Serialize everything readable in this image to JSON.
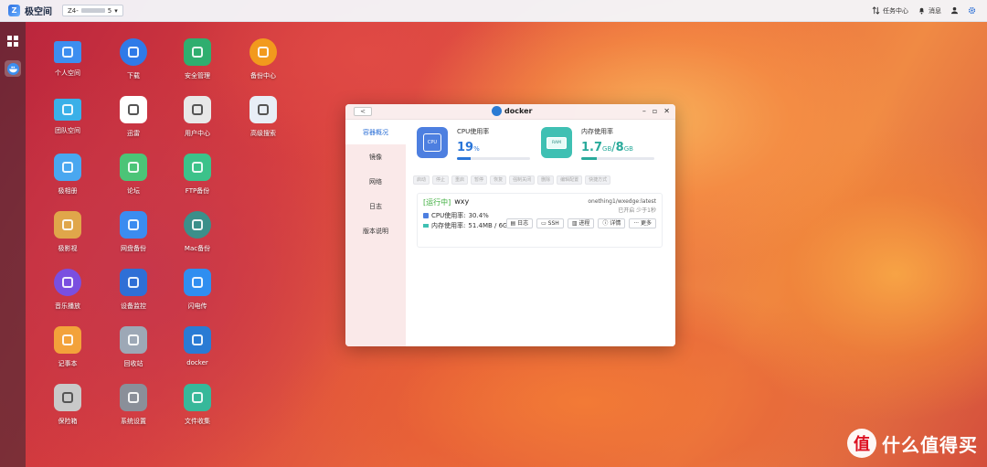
{
  "topbar": {
    "app_name": "极空间",
    "device_name": "Z4-",
    "device_suffix": "5",
    "task_center": "任务中心",
    "messages": "消息"
  },
  "desktop_icons": [
    {
      "label": "个人空间",
      "icon": "folder-icon",
      "color": "#3d8ef0"
    },
    {
      "label": "下载",
      "icon": "download-globe-icon",
      "color": "#2f7ae8"
    },
    {
      "label": "安全管理",
      "icon": "shield-icon",
      "color": "#2fae6f"
    },
    {
      "label": "备份中心",
      "icon": "backup-icon",
      "color": "#f29a1d"
    },
    {
      "label": "团队空间",
      "icon": "team-folder-icon",
      "color": "#3ab0e8"
    },
    {
      "label": "迅雷",
      "icon": "thunder-icon",
      "color": "#ffffff"
    },
    {
      "label": "用户中心",
      "icon": "user-icon",
      "color": "#e8e8e8"
    },
    {
      "label": "高级搜索",
      "icon": "search-doc-icon",
      "color": "#e8eef6"
    },
    {
      "label": "极相册",
      "icon": "photo-album-icon",
      "color": "#49a7f0"
    },
    {
      "label": "论坛",
      "icon": "forum-icon",
      "color": "#4cc477"
    },
    {
      "label": "FTP备份",
      "icon": "ftp-cloud-icon",
      "color": "#3cc28a"
    },
    {
      "label": "极影视",
      "icon": "film-icon",
      "color": "#e0a64a"
    },
    {
      "label": "网盘备份",
      "icon": "cloud-backup-icon",
      "color": "#3b8cf0"
    },
    {
      "label": "Mac备份",
      "icon": "clock-icon",
      "color": "#3b8f8a"
    },
    {
      "label": "音乐播放",
      "icon": "music-icon",
      "color": "#7a4fe0"
    },
    {
      "label": "设备监控",
      "icon": "monitor-chart-icon",
      "color": "#2f6fd6"
    },
    {
      "label": "闪电传",
      "icon": "lightning-icon",
      "color": "#2f8ef0"
    },
    {
      "label": "记事本",
      "icon": "notepad-icon",
      "color": "#f3a23a"
    },
    {
      "label": "回收站",
      "icon": "trash-icon",
      "color": "#9da8b6"
    },
    {
      "label": "docker",
      "icon": "docker-icon",
      "color": "#2a7bd4"
    },
    {
      "label": "保险箱",
      "icon": "safe-icon",
      "color": "#c9c9c9"
    },
    {
      "label": "系统设置",
      "icon": "settings-icon",
      "color": "#8a8f99"
    },
    {
      "label": "文件收集",
      "icon": "file-collect-icon",
      "color": "#37b89a"
    }
  ],
  "window": {
    "title": "docker",
    "back": "<",
    "nav": [
      "容器概况",
      "镜像",
      "网络",
      "日志",
      "版本说明"
    ],
    "cpu": {
      "label": "CPU使用率",
      "value": "19",
      "unit": "%",
      "progress": 0.19,
      "chip_text": "CPU"
    },
    "mem": {
      "label": "内存使用率",
      "used": "1.7",
      "used_unit": "GB",
      "sep": "/",
      "total": "8",
      "total_unit": "GB",
      "progress": 0.21,
      "chip_text": "RAM"
    },
    "actions": [
      "启动",
      "停止",
      "重启",
      "暂停",
      "恢复",
      "强制关闭",
      "删除",
      "编辑配置",
      "快捷方式"
    ],
    "container": {
      "status": "[运行中]",
      "name": "wxy",
      "image": "onething1/wxedge:latest",
      "uptime": "已开启 少于1秒",
      "cpu_text": "CPU使用率:",
      "cpu_value": "30.4%",
      "mem_text": "内存使用率:",
      "mem_value": "51.4MB / 6GB",
      "buttons": [
        "日志",
        "SSH",
        "进程",
        "详情",
        "更多"
      ]
    }
  },
  "watermark": {
    "symbol": "值",
    "text": "什么值得买"
  }
}
